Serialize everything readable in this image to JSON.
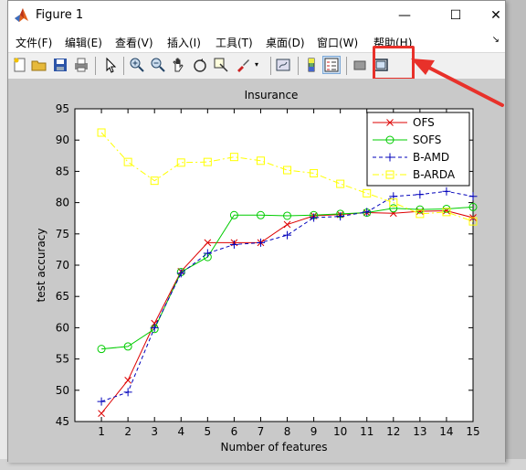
{
  "window": {
    "title": "Figure 1",
    "minimize_label": "—",
    "maximize_label": "☐",
    "close_label": "✕"
  },
  "menu": {
    "items": [
      "文件(F)",
      "编辑(E)",
      "查看(V)",
      "插入(I)",
      "工具(T)",
      "桌面(D)",
      "窗口(W)",
      "帮助(H)"
    ],
    "dock_glyph": "↘"
  },
  "toolbar": {
    "icons": [
      "new-figure-icon",
      "open-file-icon",
      "save-icon",
      "print-icon",
      "pointer-icon",
      "zoom-in-icon",
      "zoom-out-icon",
      "pan-icon",
      "rotate-3d-icon",
      "data-cursor-icon",
      "brush-icon",
      "link-plot-icon",
      "colorbar-icon",
      "legend-icon",
      "hide-plot-tools-icon",
      "show-plot-tools-icon"
    ],
    "highlight_color": "#e8312a"
  },
  "chart_data": {
    "type": "line",
    "title": "Insurance",
    "xlabel": "Number of features",
    "ylabel": "test accuracy",
    "x": [
      1,
      2,
      3,
      4,
      5,
      6,
      7,
      8,
      9,
      10,
      11,
      12,
      13,
      14,
      15
    ],
    "xlim": [
      0,
      15
    ],
    "ylim": [
      45,
      95
    ],
    "yticks": [
      45,
      50,
      55,
      60,
      65,
      70,
      75,
      80,
      85,
      90,
      95
    ],
    "xticks": [
      1,
      2,
      3,
      4,
      5,
      6,
      7,
      8,
      9,
      10,
      11,
      12,
      13,
      14,
      15
    ],
    "legend_position": "top-right",
    "grid": false,
    "series": [
      {
        "name": "OFS",
        "color": "#dd0000",
        "marker": "x",
        "dash": "solid",
        "values": [
          46.3,
          51.6,
          60.7,
          69.0,
          73.6,
          73.6,
          73.6,
          76.5,
          77.9,
          78.1,
          78.4,
          78.3,
          78.6,
          78.7,
          77.6
        ]
      },
      {
        "name": "SOFS",
        "color": "#00cc00",
        "marker": "o",
        "dash": "solid",
        "values": [
          56.6,
          57.0,
          59.8,
          68.9,
          71.3,
          78.0,
          78.0,
          77.9,
          78.0,
          78.2,
          78.4,
          79.1,
          78.9,
          79.0,
          79.3
        ]
      },
      {
        "name": "B-AMD",
        "color": "#0000bb",
        "marker": "+",
        "dash": "dashed",
        "values": [
          48.2,
          49.7,
          60.0,
          68.7,
          71.9,
          73.3,
          73.6,
          74.8,
          77.6,
          77.8,
          78.5,
          81.0,
          81.3,
          81.8,
          81.0
        ]
      },
      {
        "name": "B-ARDA",
        "color": "#ffff00",
        "marker": "s",
        "dash": "dashdot",
        "values": [
          91.2,
          86.5,
          83.5,
          86.4,
          86.5,
          87.3,
          86.7,
          85.2,
          84.7,
          83.0,
          81.5,
          80.0,
          78.2,
          78.5,
          77.0
        ]
      }
    ]
  }
}
